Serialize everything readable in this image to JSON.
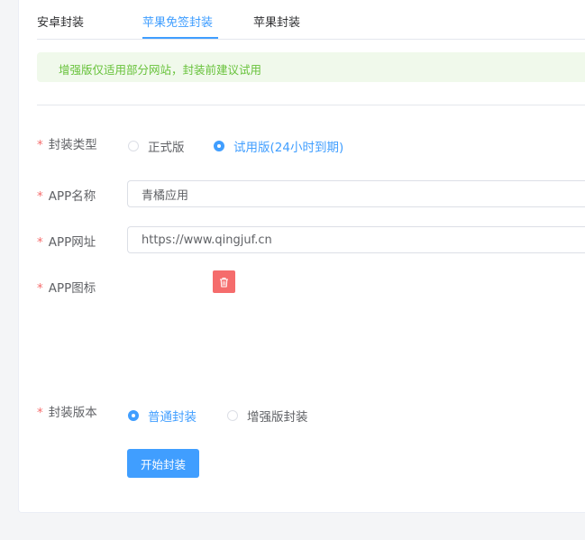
{
  "tabs": [
    {
      "label": "安卓封装"
    },
    {
      "label": "苹果免签封装",
      "active": true
    },
    {
      "label": "苹果封装"
    }
  ],
  "alert": {
    "text": "增强版仅适用部分网站，封装前建议试用",
    "color": "#67c23a"
  },
  "form": {
    "required_mark": "*",
    "package_type": {
      "label": "封装类型",
      "options": [
        {
          "label": "正式版",
          "checked": false
        },
        {
          "label": "试用版(24小时到期)",
          "checked": true
        }
      ]
    },
    "app_name": {
      "label": "APP名称",
      "value": "青橘应用"
    },
    "app_url": {
      "label": "APP网址",
      "value": "https://www.qingjuf.cn"
    },
    "app_icon": {
      "label": "APP图标",
      "delete_icon": "trash-icon"
    },
    "package_version": {
      "label": "封装版本",
      "options": [
        {
          "label": "普通封装",
          "checked": true
        },
        {
          "label": "增强版封装",
          "checked": false
        }
      ]
    },
    "submit_label": "开始封装"
  },
  "colors": {
    "primary": "#409eff",
    "danger": "#f56c6c",
    "success": "#67c23a"
  }
}
